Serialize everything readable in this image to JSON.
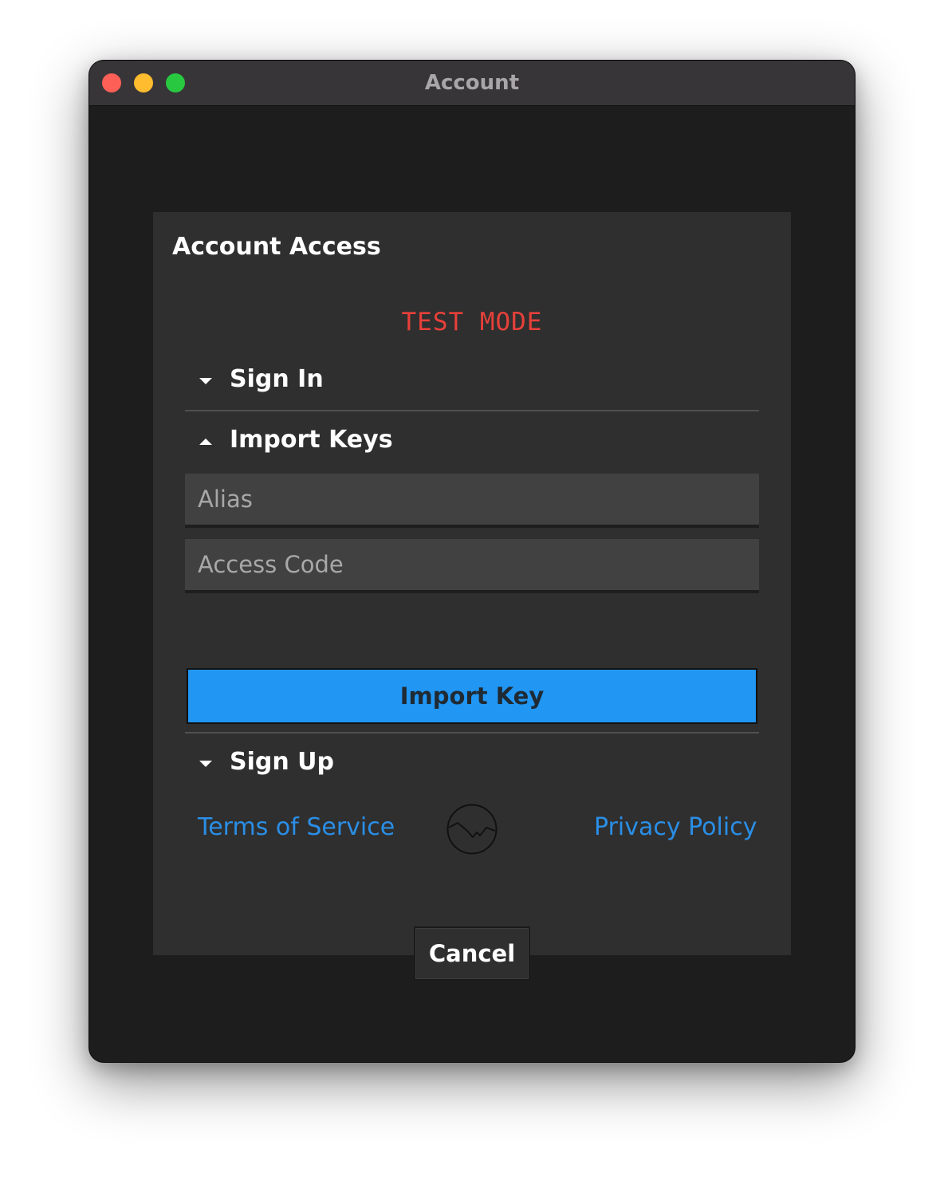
{
  "window": {
    "title": "Account"
  },
  "dialog": {
    "title": "Account Access",
    "mode_banner": "TEST MODE",
    "sections": {
      "sign_in": {
        "label": "Sign In",
        "expanded": false,
        "icon": "chevron-down-icon"
      },
      "import_keys": {
        "label": "Import Keys",
        "expanded": true,
        "icon": "chevron-up-icon"
      },
      "sign_up": {
        "label": "Sign Up",
        "expanded": false,
        "icon": "chevron-down-icon"
      }
    },
    "import_form": {
      "alias": {
        "value": "",
        "placeholder": "Alias"
      },
      "access_code": {
        "value": "",
        "placeholder": "Access Code"
      },
      "submit_label": "Import Key"
    },
    "footer": {
      "terms_label": "Terms of Service",
      "privacy_label": "Privacy Policy",
      "logo_icon": "wave-circle-logo",
      "cancel_label": "Cancel"
    }
  },
  "colors": {
    "window_bg": "#1d1d1e",
    "titlebar_bg": "#383538",
    "dialog_bg": "#2f2f2f",
    "accent": "#2196f3",
    "link": "#2a8ee6",
    "test_mode": "#e8403a",
    "field_bg": "#414141"
  }
}
